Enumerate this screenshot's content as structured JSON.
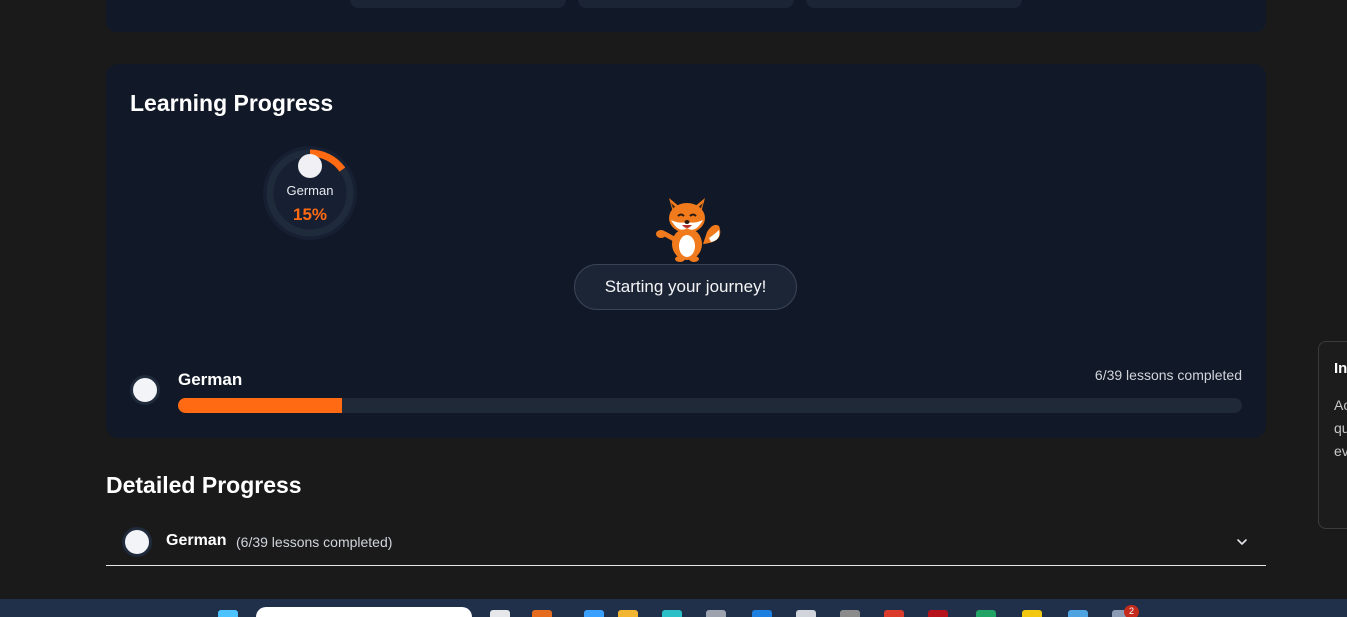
{
  "progress_card": {
    "title": "Learning Progress",
    "ring": {
      "language": "German",
      "percent_label": "15%",
      "percent": 0.15
    },
    "mascot_message": "Starting your journey!",
    "course": {
      "language": "German",
      "lessons_label": "6/39 lessons completed",
      "completed": 6,
      "total": 39
    }
  },
  "detailed_progress": {
    "title": "Detailed Progress",
    "rows": [
      {
        "language": "German",
        "summary": "(6/39 lessons completed)"
      }
    ]
  },
  "side_panel": {
    "title": "In",
    "text_lines": [
      "Ac",
      "qu",
      "ev"
    ]
  },
  "taskbar": {
    "notification_count": "2"
  },
  "colors": {
    "accent": "#ff6a13",
    "card_bg": "#111827",
    "page_bg": "#1a1a1a"
  }
}
